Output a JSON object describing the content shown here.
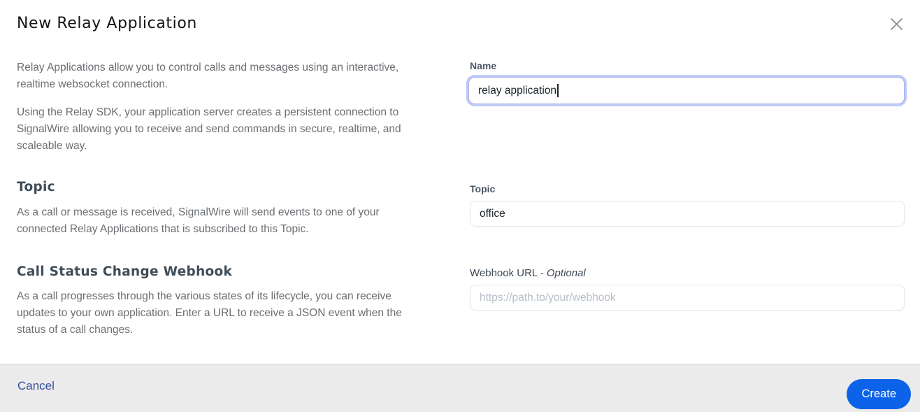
{
  "dialog": {
    "title": "New Relay Application"
  },
  "intro": {
    "paragraph1": "Relay Applications allow you to control calls and messages using an interactive, realtime websocket connection.",
    "paragraph2": "Using the Relay SDK, your application server creates a persistent connection to SignalWire allowing you to receive and send commands in secure, realtime, and scaleable way."
  },
  "name_field": {
    "label": "Name",
    "value": "relay application"
  },
  "topic_section": {
    "heading": "Topic",
    "description": "As a call or message is received, SignalWire will send events to one of your connected Relay Applications that is subscribed to this Topic."
  },
  "topic_field": {
    "label": "Topic",
    "value": "office"
  },
  "webhook_section": {
    "heading": "Call Status Change Webhook",
    "description": "As a call progresses through the various states of its lifecycle, you can receive updates to your own application. Enter a URL to receive a JSON event when the status of a call changes."
  },
  "webhook_field": {
    "label": "Webhook URL -",
    "optional_label": "Optional",
    "placeholder": "https://path.to/your/webhook"
  },
  "footer": {
    "cancel_label": "Cancel",
    "create_label": "Create"
  },
  "colors": {
    "accent_blue": "#0c62e9",
    "cancel_blue": "#36519f",
    "focus_ring": "#c0cbf6",
    "footer_bg": "#ebebeb"
  }
}
